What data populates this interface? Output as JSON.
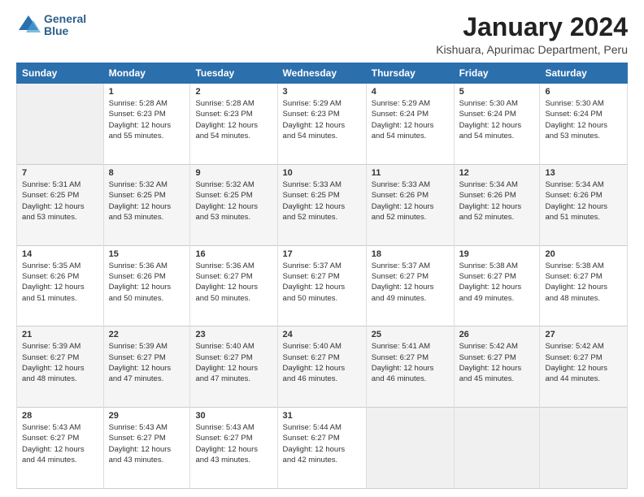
{
  "logo": {
    "line1": "General",
    "line2": "Blue"
  },
  "title": "January 2024",
  "subtitle": "Kishuara, Apurimac Department, Peru",
  "days_header": [
    "Sunday",
    "Monday",
    "Tuesday",
    "Wednesday",
    "Thursday",
    "Friday",
    "Saturday"
  ],
  "weeks": [
    [
      {
        "day": "",
        "info": ""
      },
      {
        "day": "1",
        "info": "Sunrise: 5:28 AM\nSunset: 6:23 PM\nDaylight: 12 hours\nand 55 minutes."
      },
      {
        "day": "2",
        "info": "Sunrise: 5:28 AM\nSunset: 6:23 PM\nDaylight: 12 hours\nand 54 minutes."
      },
      {
        "day": "3",
        "info": "Sunrise: 5:29 AM\nSunset: 6:23 PM\nDaylight: 12 hours\nand 54 minutes."
      },
      {
        "day": "4",
        "info": "Sunrise: 5:29 AM\nSunset: 6:24 PM\nDaylight: 12 hours\nand 54 minutes."
      },
      {
        "day": "5",
        "info": "Sunrise: 5:30 AM\nSunset: 6:24 PM\nDaylight: 12 hours\nand 54 minutes."
      },
      {
        "day": "6",
        "info": "Sunrise: 5:30 AM\nSunset: 6:24 PM\nDaylight: 12 hours\nand 53 minutes."
      }
    ],
    [
      {
        "day": "7",
        "info": "Sunrise: 5:31 AM\nSunset: 6:25 PM\nDaylight: 12 hours\nand 53 minutes."
      },
      {
        "day": "8",
        "info": "Sunrise: 5:32 AM\nSunset: 6:25 PM\nDaylight: 12 hours\nand 53 minutes."
      },
      {
        "day": "9",
        "info": "Sunrise: 5:32 AM\nSunset: 6:25 PM\nDaylight: 12 hours\nand 53 minutes."
      },
      {
        "day": "10",
        "info": "Sunrise: 5:33 AM\nSunset: 6:25 PM\nDaylight: 12 hours\nand 52 minutes."
      },
      {
        "day": "11",
        "info": "Sunrise: 5:33 AM\nSunset: 6:26 PM\nDaylight: 12 hours\nand 52 minutes."
      },
      {
        "day": "12",
        "info": "Sunrise: 5:34 AM\nSunset: 6:26 PM\nDaylight: 12 hours\nand 52 minutes."
      },
      {
        "day": "13",
        "info": "Sunrise: 5:34 AM\nSunset: 6:26 PM\nDaylight: 12 hours\nand 51 minutes."
      }
    ],
    [
      {
        "day": "14",
        "info": "Sunrise: 5:35 AM\nSunset: 6:26 PM\nDaylight: 12 hours\nand 51 minutes."
      },
      {
        "day": "15",
        "info": "Sunrise: 5:36 AM\nSunset: 6:26 PM\nDaylight: 12 hours\nand 50 minutes."
      },
      {
        "day": "16",
        "info": "Sunrise: 5:36 AM\nSunset: 6:27 PM\nDaylight: 12 hours\nand 50 minutes."
      },
      {
        "day": "17",
        "info": "Sunrise: 5:37 AM\nSunset: 6:27 PM\nDaylight: 12 hours\nand 50 minutes."
      },
      {
        "day": "18",
        "info": "Sunrise: 5:37 AM\nSunset: 6:27 PM\nDaylight: 12 hours\nand 49 minutes."
      },
      {
        "day": "19",
        "info": "Sunrise: 5:38 AM\nSunset: 6:27 PM\nDaylight: 12 hours\nand 49 minutes."
      },
      {
        "day": "20",
        "info": "Sunrise: 5:38 AM\nSunset: 6:27 PM\nDaylight: 12 hours\nand 48 minutes."
      }
    ],
    [
      {
        "day": "21",
        "info": "Sunrise: 5:39 AM\nSunset: 6:27 PM\nDaylight: 12 hours\nand 48 minutes."
      },
      {
        "day": "22",
        "info": "Sunrise: 5:39 AM\nSunset: 6:27 PM\nDaylight: 12 hours\nand 47 minutes."
      },
      {
        "day": "23",
        "info": "Sunrise: 5:40 AM\nSunset: 6:27 PM\nDaylight: 12 hours\nand 47 minutes."
      },
      {
        "day": "24",
        "info": "Sunrise: 5:40 AM\nSunset: 6:27 PM\nDaylight: 12 hours\nand 46 minutes."
      },
      {
        "day": "25",
        "info": "Sunrise: 5:41 AM\nSunset: 6:27 PM\nDaylight: 12 hours\nand 46 minutes."
      },
      {
        "day": "26",
        "info": "Sunrise: 5:42 AM\nSunset: 6:27 PM\nDaylight: 12 hours\nand 45 minutes."
      },
      {
        "day": "27",
        "info": "Sunrise: 5:42 AM\nSunset: 6:27 PM\nDaylight: 12 hours\nand 44 minutes."
      }
    ],
    [
      {
        "day": "28",
        "info": "Sunrise: 5:43 AM\nSunset: 6:27 PM\nDaylight: 12 hours\nand 44 minutes."
      },
      {
        "day": "29",
        "info": "Sunrise: 5:43 AM\nSunset: 6:27 PM\nDaylight: 12 hours\nand 43 minutes."
      },
      {
        "day": "30",
        "info": "Sunrise: 5:43 AM\nSunset: 6:27 PM\nDaylight: 12 hours\nand 43 minutes."
      },
      {
        "day": "31",
        "info": "Sunrise: 5:44 AM\nSunset: 6:27 PM\nDaylight: 12 hours\nand 42 minutes."
      },
      {
        "day": "",
        "info": ""
      },
      {
        "day": "",
        "info": ""
      },
      {
        "day": "",
        "info": ""
      }
    ]
  ]
}
